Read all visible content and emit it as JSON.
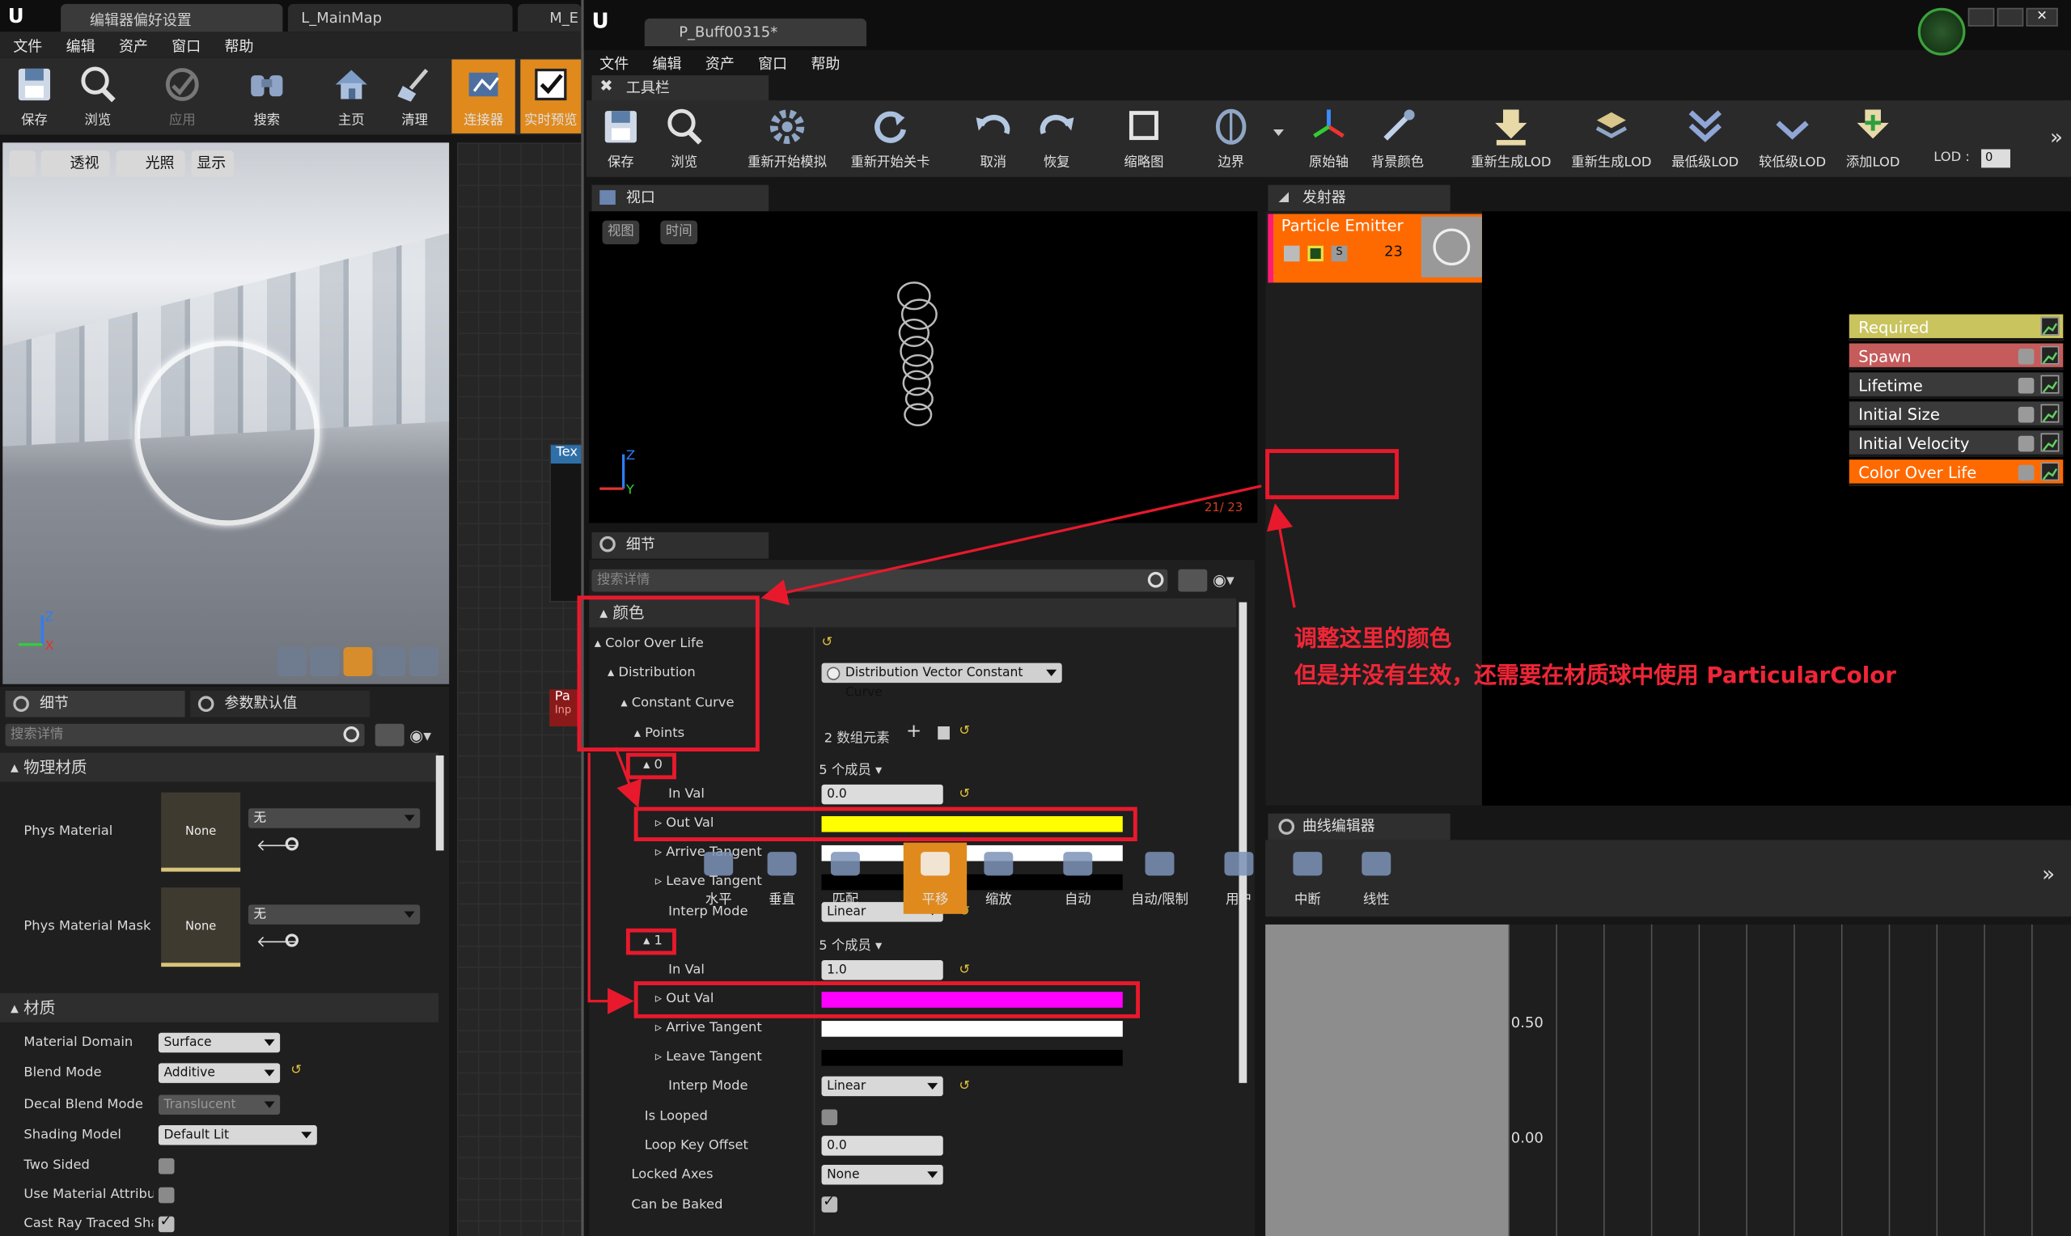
{
  "left_window": {
    "tabs": [
      "编辑器偏好设置",
      "L_MainMap",
      "M_E"
    ],
    "menu": [
      "文件",
      "编辑",
      "资产",
      "窗口",
      "帮助"
    ],
    "toolbar": [
      "保存",
      "浏览",
      "应用",
      "搜索",
      "主页",
      "清理",
      "连接器",
      "实时预览"
    ],
    "viewport_buttons": [
      "透视",
      "光照",
      "显示"
    ],
    "details_tab": "细节",
    "params_tab": "参数默认值",
    "search_placeholder": "搜索详情",
    "physical_material_section": "物理材质",
    "phys_material_label": "Phys Material",
    "phys_material_mask_label": "Phys Material Mask",
    "none_thumb": "None",
    "none_value": "无",
    "material_section": "材质",
    "props": [
      {
        "label": "Material Domain",
        "value": "Surface"
      },
      {
        "label": "Blend Mode",
        "value": "Additive"
      },
      {
        "label": "Decal Blend Mode",
        "value": "Translucent"
      },
      {
        "label": "Shading Model",
        "value": "Default Lit"
      },
      {
        "label": "Two Sided",
        "value": ""
      },
      {
        "label": "Use Material Attributes",
        "value": ""
      },
      {
        "label": "Cast Ray Traced Shad",
        "value": ""
      }
    ],
    "graph_node_texts": [
      "Tex",
      "Pa",
      "Inp"
    ]
  },
  "right_window": {
    "tab_title": "P_Buff00315*",
    "menu": [
      "文件",
      "编辑",
      "资产",
      "窗口",
      "帮助"
    ],
    "toolbar_tab": "工具栏",
    "toolbar": [
      "保存",
      "浏览",
      "重新开始模拟",
      "重新开始关卡",
      "取消",
      "恢复",
      "缩略图",
      "边界",
      "原始轴",
      "背景颜色",
      "重新生成LOD",
      "重新生成LOD",
      "最低级LOD",
      "较低级LOD",
      "添加LOD"
    ],
    "lod_label": "LOD :",
    "lod_value": "0",
    "viewport_tab": "视口",
    "viewport_buttons": [
      "视图",
      "时间"
    ],
    "viewport_counter": "21/ 23",
    "emitter_tab": "发射器",
    "emitter_name": "Particle Emitter",
    "emitter_count": "23",
    "modules": [
      {
        "name": "Required",
        "color": "#c9c45e"
      },
      {
        "name": "Spawn",
        "color": "#c65b5b"
      },
      {
        "name": "Lifetime",
        "color": "#3a3a3a"
      },
      {
        "name": "Initial Size",
        "color": "#3a3a3a"
      },
      {
        "name": "Initial Velocity",
        "color": "#3a3a3a"
      },
      {
        "name": "Color Over Life",
        "color": "#ff6a00"
      }
    ],
    "annotation_line1": "调整这里的颜色",
    "annotation_line2": "但是并没有生效，还需要在材质球中使用 ParticularColor",
    "details_tab": "细节",
    "details_search_placeholder": "搜索详情",
    "details": {
      "section": "颜色",
      "color_over_life": "Color Over Life",
      "distribution": "Distribution",
      "distribution_value": "Distribution Vector Constant Curve",
      "constant_curve": "Constant Curve",
      "points": "Points",
      "points_value": "2 数组元素",
      "point0_index": "0",
      "point1_index": "1",
      "members": "5 个成员",
      "in_val": "In Val",
      "in_val0": "0.0",
      "in_val1": "1.0",
      "out_val": "Out Val",
      "out_color0": "#ffff00",
      "out_color1": "#ff00ff",
      "arrive_tangent": "Arrive Tangent",
      "leave_tangent": "Leave Tangent",
      "interp_mode": "Interp Mode",
      "interp_value": "Linear",
      "is_looped": "Is Looped",
      "loop_key_offset": "Loop Key Offset",
      "loop_key_offset_value": "0.0",
      "locked_axes": "Locked Axes",
      "locked_axes_value": "None",
      "can_be_baked": "Can be Baked"
    },
    "curve_editor_tab": "曲线编辑器",
    "curve_tools": [
      "水平",
      "垂直",
      "匹配",
      "平移",
      "缩放",
      "自动",
      "自动/限制",
      "用户",
      "中断",
      "线性"
    ],
    "curve_axis": [
      "0.50",
      "0.00"
    ]
  }
}
